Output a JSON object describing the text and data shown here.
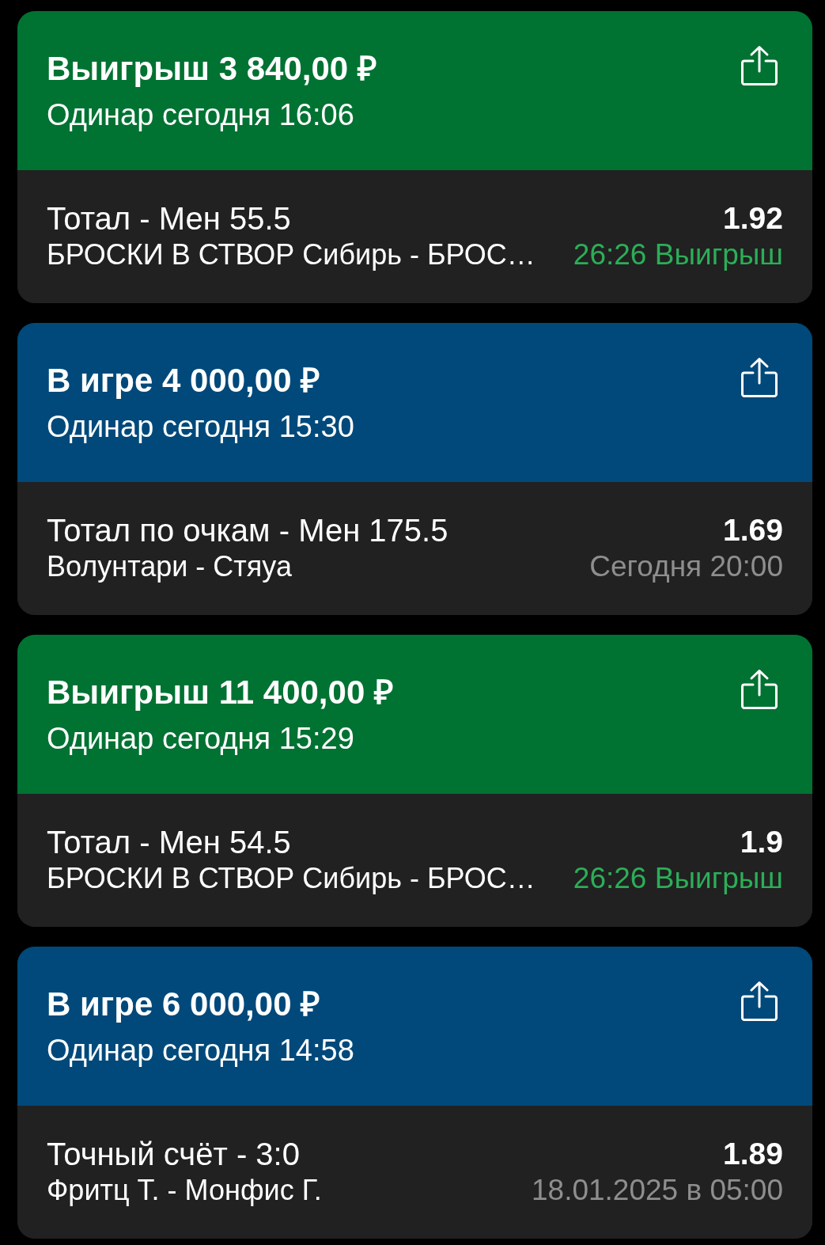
{
  "bets": [
    {
      "kind": "won",
      "title": "Выигрыш 3 840,00 ₽",
      "subtitle": "Одинар сегодня 16:06",
      "market": "Тотал - Мен 55.5",
      "match": "БРОСКИ В СТВОР Сибирь - БРОС…",
      "odds": "1.92",
      "status": "26:26 Выигрыш"
    },
    {
      "kind": "in_play",
      "title": "В игре 4 000,00 ₽",
      "subtitle": "Одинар сегодня 15:30",
      "market": "Тотал по очкам - Мен 175.5",
      "match": "Волунтари - Стяуа",
      "odds": "1.69",
      "status": "Сегодня 20:00"
    },
    {
      "kind": "won",
      "title": "Выигрыш 11 400,00 ₽",
      "subtitle": "Одинар сегодня 15:29",
      "market": "Тотал - Мен 54.5",
      "match": "БРОСКИ В СТВОР Сибирь - БРОС…",
      "odds": "1.9",
      "status": "26:26 Выигрыш"
    },
    {
      "kind": "in_play",
      "title": "В игре 6 000,00 ₽",
      "subtitle": "Одинар сегодня 14:58",
      "market": "Точный счёт - 3:0",
      "match": "Фритц Т. - Монфис Г.",
      "odds": "1.89",
      "status": "18.01.2025 в 05:00"
    }
  ]
}
